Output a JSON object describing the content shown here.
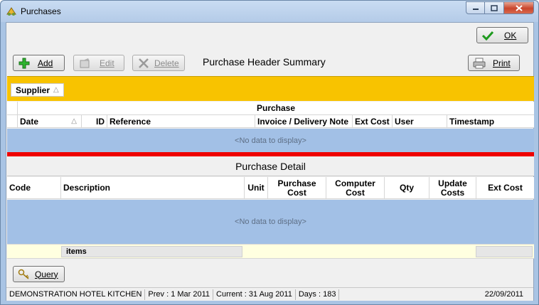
{
  "window": {
    "title": "Purchases",
    "buttons": [
      "minimize",
      "maximize",
      "close"
    ]
  },
  "toolbar": {
    "ok_label": "OK",
    "add_label": "Add",
    "edit_label": "Edit",
    "delete_label": "Delete",
    "print_label": "Print",
    "header_title": "Purchase Header Summary"
  },
  "header_grid": {
    "group_by": "Supplier",
    "band_label": "Purchase",
    "columns": [
      "Date",
      "ID",
      "Reference",
      "Invoice / Delivery Note",
      "Ext Cost",
      "User",
      "Timestamp"
    ],
    "empty_text": "<No data to display>"
  },
  "detail_grid": {
    "title": "Purchase Detail",
    "columns": [
      "Code",
      "Description",
      "Unit",
      "Purchase Cost",
      "Computer Cost",
      "Qty",
      "Update Costs",
      "Ext Cost"
    ],
    "empty_text": "<No data to display>",
    "footer_items_label": "items"
  },
  "query_label": "Query",
  "status": {
    "company": "DEMONSTRATION HOTEL KITCHEN",
    "prev": "Prev : 1 Mar 2011",
    "current": "Current : 31 Aug 2011",
    "days": "Days : 183",
    "date": "22/09/2011"
  },
  "colors": {
    "group_bar": "#f8c300",
    "splitter": "#ee0000",
    "empty_area": "#a2c0e6",
    "footer": "#ffffe0"
  }
}
